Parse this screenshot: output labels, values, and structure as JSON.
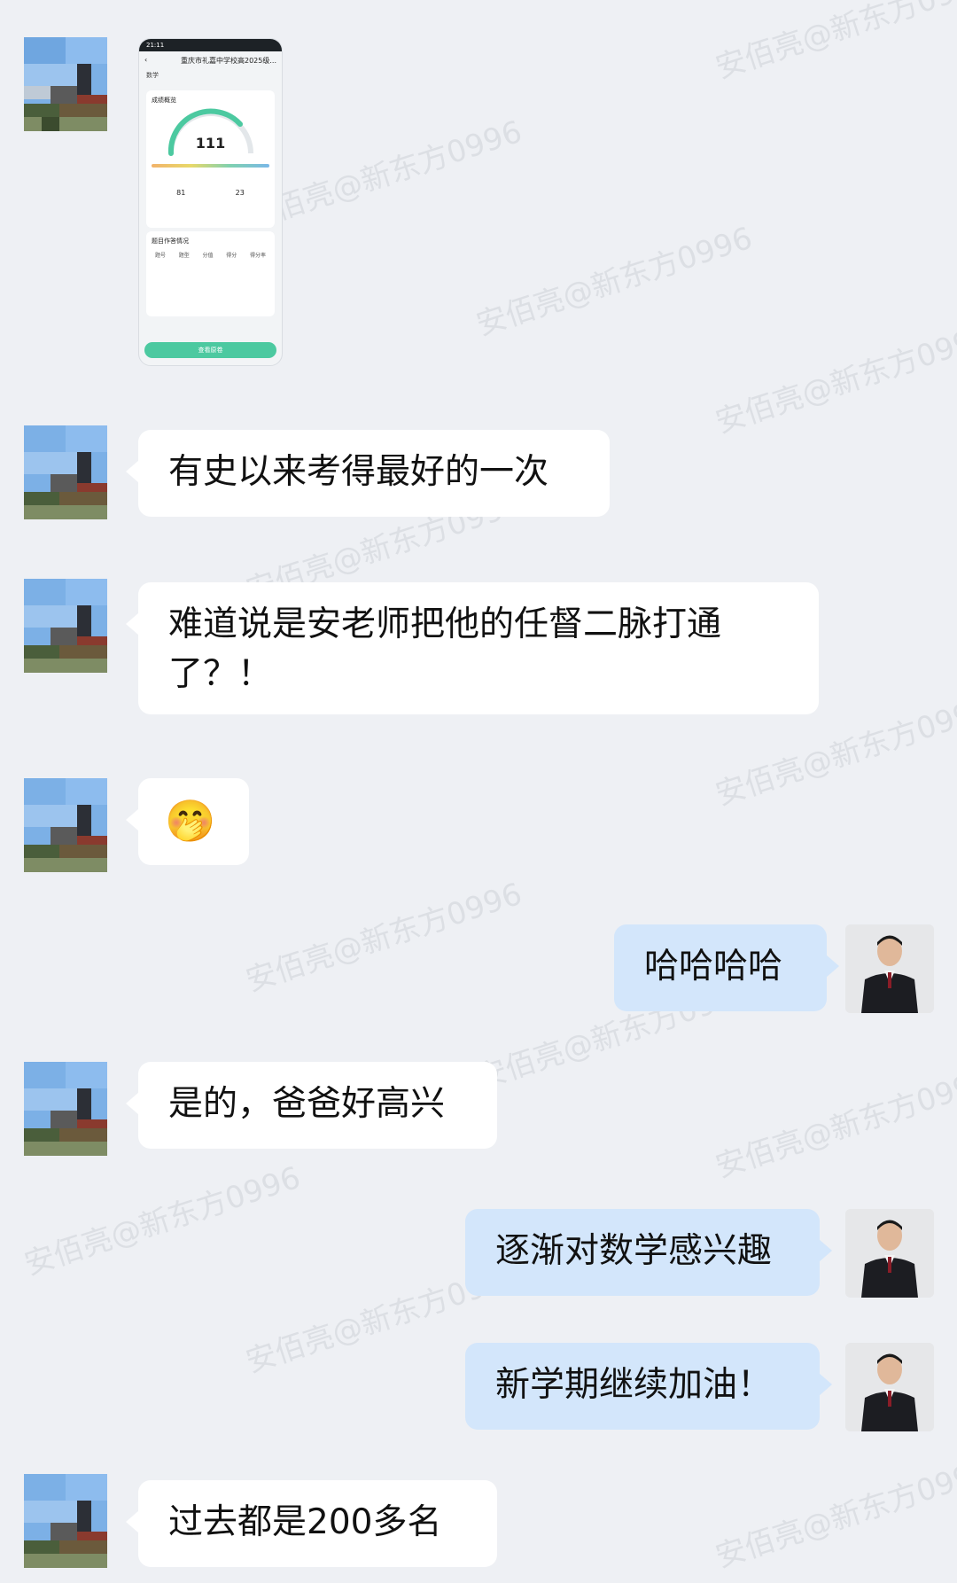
{
  "watermark": "安佰亮@新东方0996",
  "thumbnail": {
    "status_time": "21:11",
    "header_title": "重庆市礼嘉中学校高2025级...",
    "subject": "数学",
    "section_title": "成绩概览",
    "score": "111",
    "stat_left": "81",
    "stat_right": "23",
    "list_title": "题目作答情况",
    "col_1": "题号",
    "col_2": "题型",
    "col_3": "分值",
    "col_4": "得分",
    "col_5": "得分率",
    "button": "查看原卷"
  },
  "messages": [
    {
      "side": "left",
      "type": "text",
      "text": "有史以来考得最好的一次"
    },
    {
      "side": "left",
      "type": "text",
      "text": "难道说是安老师把他的任督二脉打通了？！"
    },
    {
      "side": "left",
      "type": "emoji",
      "icon": "shy-face-emoji",
      "text": "🤭"
    },
    {
      "side": "right",
      "type": "text",
      "text": "哈哈哈哈"
    },
    {
      "side": "left",
      "type": "text",
      "text": "是的，爸爸好高兴"
    },
    {
      "side": "right",
      "type": "text",
      "text": "逐渐对数学感兴趣"
    },
    {
      "side": "right",
      "type": "text",
      "text": "新学期继续加油！"
    },
    {
      "side": "left",
      "type": "text",
      "text": "过去都是200多名"
    }
  ]
}
